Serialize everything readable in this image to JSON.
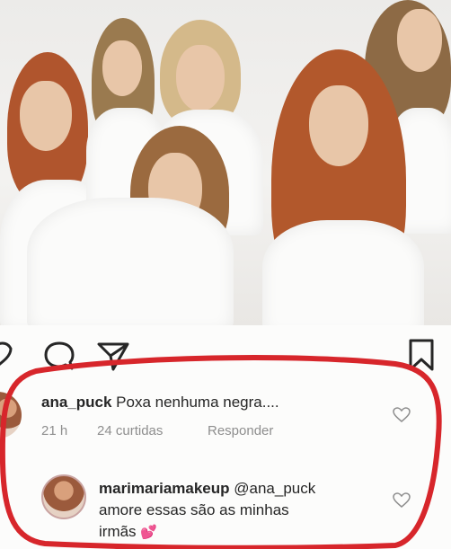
{
  "post": {
    "image_alt": "Group photo of six women in white shirts"
  },
  "comments": [
    {
      "username": "ana_puck",
      "text": "Poxa nenhuma negra....",
      "time": "21 h",
      "likes": "24 curtidas",
      "reply_label": "Responder"
    },
    {
      "username": "marimariamakeup",
      "mention": "@ana_puck",
      "text_line1": "amore essas são as minhas",
      "text_line2": "irmãs",
      "emoji": "💕"
    }
  ],
  "colors": {
    "highlight_circle": "#d7262b",
    "meta_text": "#8e8e8e",
    "heart_emoji": "#d94fa0"
  }
}
